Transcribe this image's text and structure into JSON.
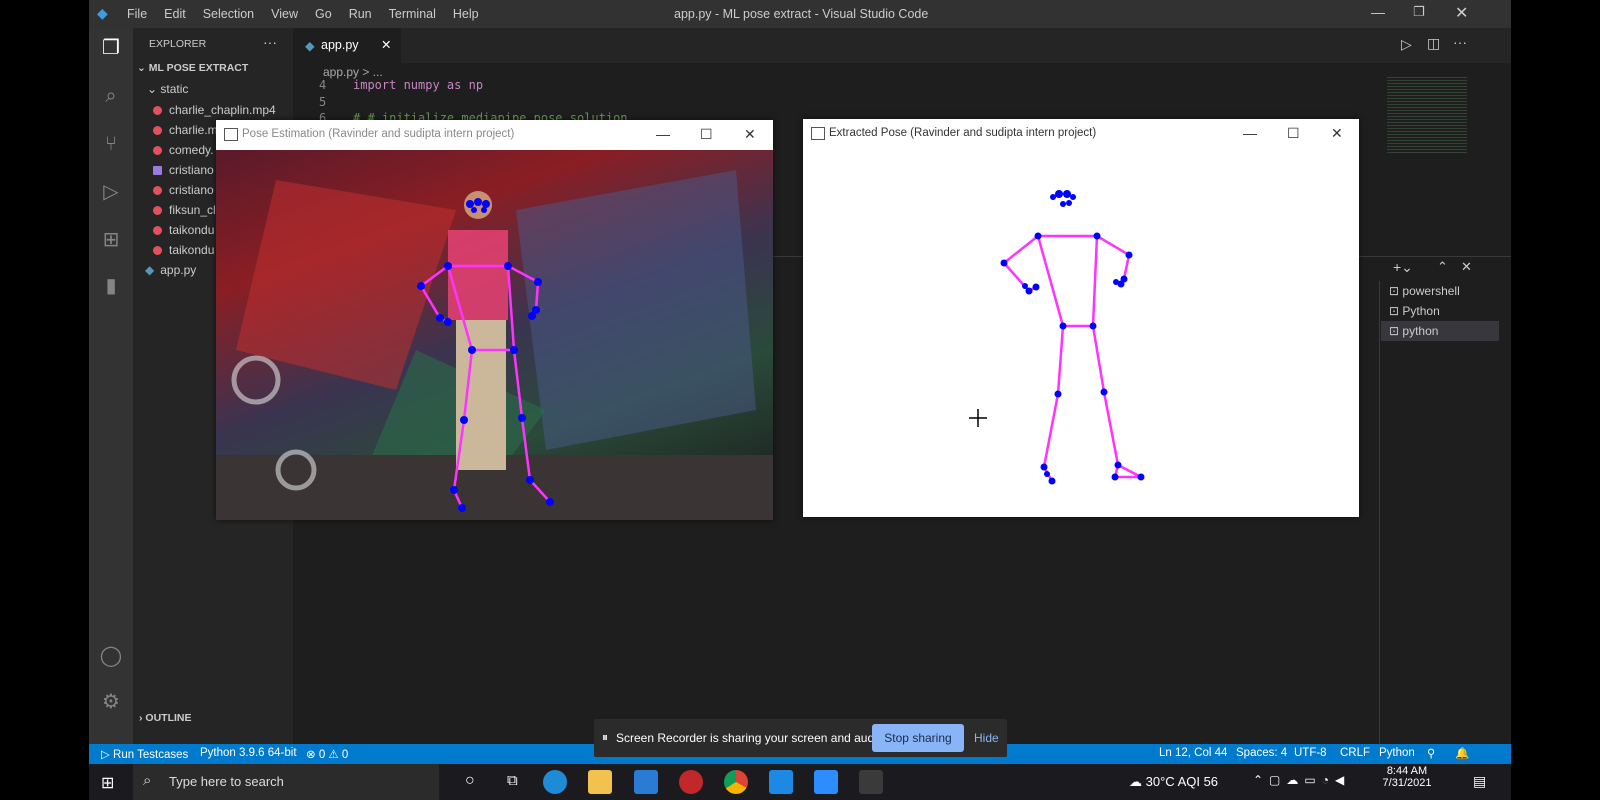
{
  "window_title": "app.py - ML pose extract - Visual Studio Code",
  "menu": [
    "File",
    "Edit",
    "Selection",
    "View",
    "Go",
    "Run",
    "Terminal",
    "Help"
  ],
  "explorer": {
    "header": "EXPLORER",
    "folder": "ML POSE EXTRACT",
    "static_folder": "static",
    "files": [
      "charlie_chaplin.mp4",
      "charlie.m",
      "comedy.",
      "cristiano",
      "cristiano",
      "fiksun_cl",
      "taikondu",
      "taikondu"
    ],
    "app_file": "app.py",
    "outline": "OUTLINE"
  },
  "editor": {
    "tab": "app.py",
    "breadcrumb": "app.py > ...",
    "line4": "import numpy as np",
    "line6": "# # initialize mediapipe pose solution",
    "ln4": "4",
    "ln5": "5",
    "ln6": "6"
  },
  "terminals": [
    "powershell",
    "Python",
    "python"
  ],
  "pose_window": {
    "title": "Pose Estimation (Ravinder and sudipta intern project)"
  },
  "extract_window": {
    "title": "Extracted Pose (Ravinder and sudipta intern project)"
  },
  "status": {
    "run": "Run Testcases",
    "python": "Python 3.9.6 64-bit",
    "problems": "⊗ 0 ⚠ 0",
    "position": "Ln 12, Col 44",
    "spaces": "Spaces: 4",
    "encoding": "UTF-8",
    "eol": "CRLF",
    "language": "Python"
  },
  "share_bar": {
    "text": "Screen Recorder is sharing your screen and audio.",
    "stop": "Stop sharing",
    "hide": "Hide"
  },
  "taskbar": {
    "search_placeholder": "Type here to search",
    "weather": "30°C AQI 56",
    "time": "8:44 AM",
    "date": "7/31/2021"
  },
  "colors": {
    "accent": "#007acc",
    "pose_line": "#ff33ff",
    "pose_dot": "#0000ff"
  }
}
